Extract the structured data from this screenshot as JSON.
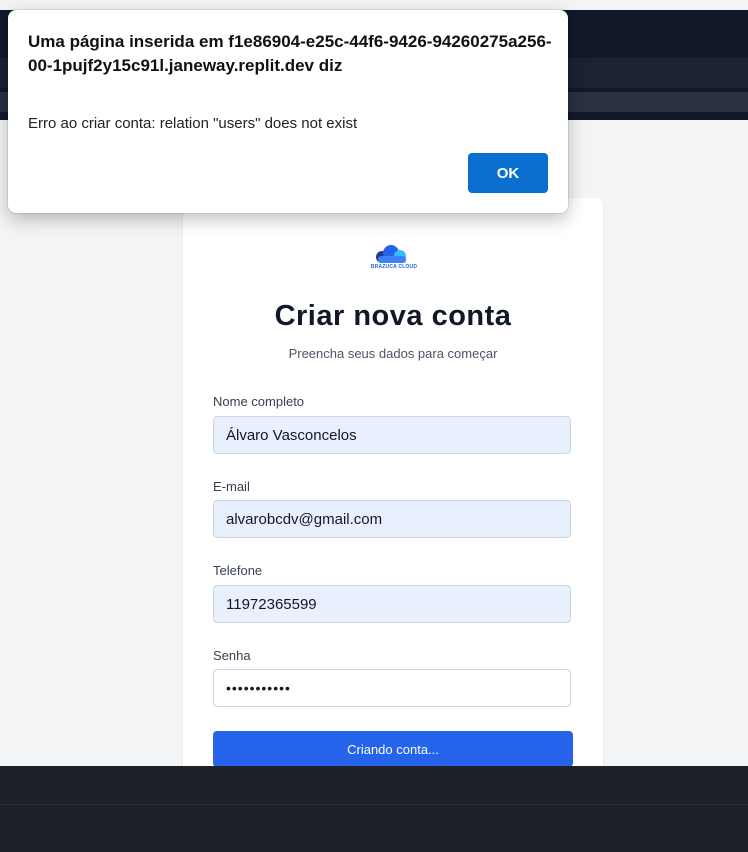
{
  "dialog": {
    "title": "Uma página inserida em f1e86904-e25c-44f6-9426-94260275a256-00-1pujf2y15c91l.janeway.replit.dev diz",
    "message": "Erro ao criar conta: relation \"users\" does not exist",
    "ok_label": "OK"
  },
  "brand": {
    "logo_text": "BRAZUCA CLOUD",
    "colors": {
      "primary": "#2563eb",
      "accent": "#38bdf8",
      "dark": "#1e3a8a"
    }
  },
  "form": {
    "title": "Criar nova conta",
    "subtitle": "Preencha seus dados para começar",
    "fields": {
      "name": {
        "label": "Nome completo",
        "value": "Álvaro Vasconcelos"
      },
      "email": {
        "label": "E-mail",
        "value": "alvarobcdv@gmail.com"
      },
      "phone": {
        "label": "Telefone",
        "value": "11972365599"
      },
      "password": {
        "label": "Senha",
        "value": "•••••••••••"
      }
    },
    "submit_label": "Criando conta..."
  }
}
